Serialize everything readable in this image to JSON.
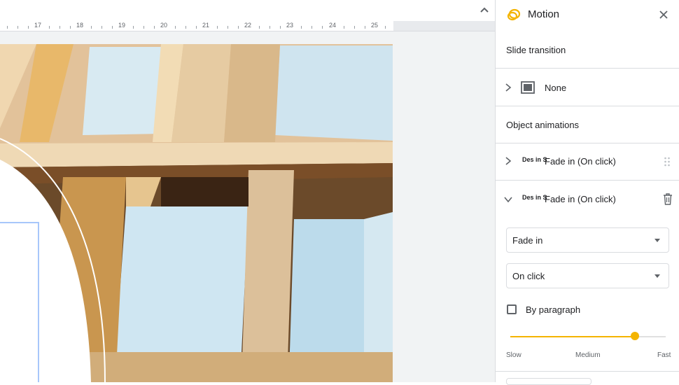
{
  "ruler": {
    "numbers": [
      "17",
      "18",
      "19",
      "20",
      "21",
      "22",
      "23",
      "24",
      "25"
    ]
  },
  "panel": {
    "title": "Motion",
    "slide_transition_label": "Slide transition",
    "transition_value": "None",
    "object_animations_label": "Object animations",
    "animations": [
      {
        "thumb_text": "Des in S",
        "label": "Fade in  (On click)",
        "expanded": false
      },
      {
        "thumb_text": "Des in S",
        "label": "Fade in  (On click)",
        "expanded": true
      }
    ],
    "effect_select": "Fade in",
    "trigger_select": "On click",
    "by_paragraph_label": "By paragraph",
    "by_paragraph_checked": false,
    "speed": {
      "value": 0.8,
      "labels": {
        "slow": "Slow",
        "medium": "Medium",
        "fast": "Fast"
      }
    }
  },
  "colors": {
    "accent": "#f4b400",
    "divider": "#dadce0"
  },
  "icons": {
    "motion": "motion-icon",
    "close": "close-icon",
    "collapse": "chevron-up-icon",
    "delete": "trash-icon",
    "drag": "drag-handle-icon"
  }
}
